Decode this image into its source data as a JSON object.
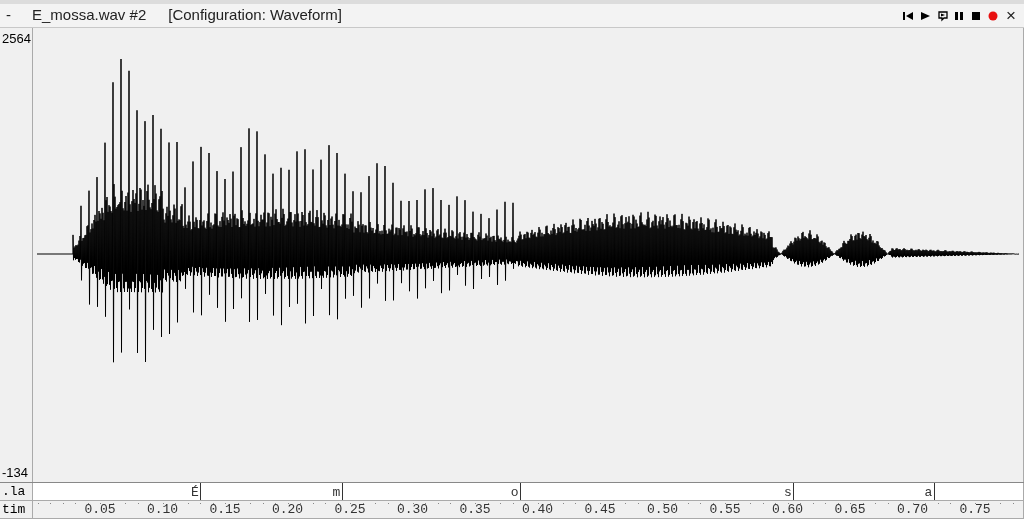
{
  "window": {
    "menu_glyph": "-",
    "file": "E_mossa.wav #2",
    "configuration": "[Configuration: Waveform]"
  },
  "transport": {
    "buttons": [
      {
        "kind": "skip-start"
      },
      {
        "kind": "play"
      },
      {
        "kind": "loop"
      },
      {
        "kind": "pause"
      },
      {
        "kind": "stop"
      },
      {
        "kind": "record"
      }
    ],
    "close": "×"
  },
  "waveform": {
    "y_max": "2564",
    "y_min": "-134"
  },
  "tiers": [
    {
      "name": ".la",
      "kind": "labels",
      "segments": [
        {
          "label": "É",
          "level": 0.169
        },
        {
          "label": "m",
          "level": 0.312
        },
        {
          "label": "o",
          "level": 0.492
        },
        {
          "label": "s",
          "level": 0.768
        },
        {
          "label": "a",
          "level": 0.91
        }
      ]
    },
    {
      "name": "tim",
      "kind": "time",
      "ticks": [
        "0.05",
        "0.10",
        "0.15",
        "0.20",
        "0.25",
        "0.30",
        "0.35",
        "0.40",
        "0.45",
        "0.50",
        "0.55",
        "0.60",
        "0.65",
        "0.70",
        "0.75"
      ]
    }
  ]
}
